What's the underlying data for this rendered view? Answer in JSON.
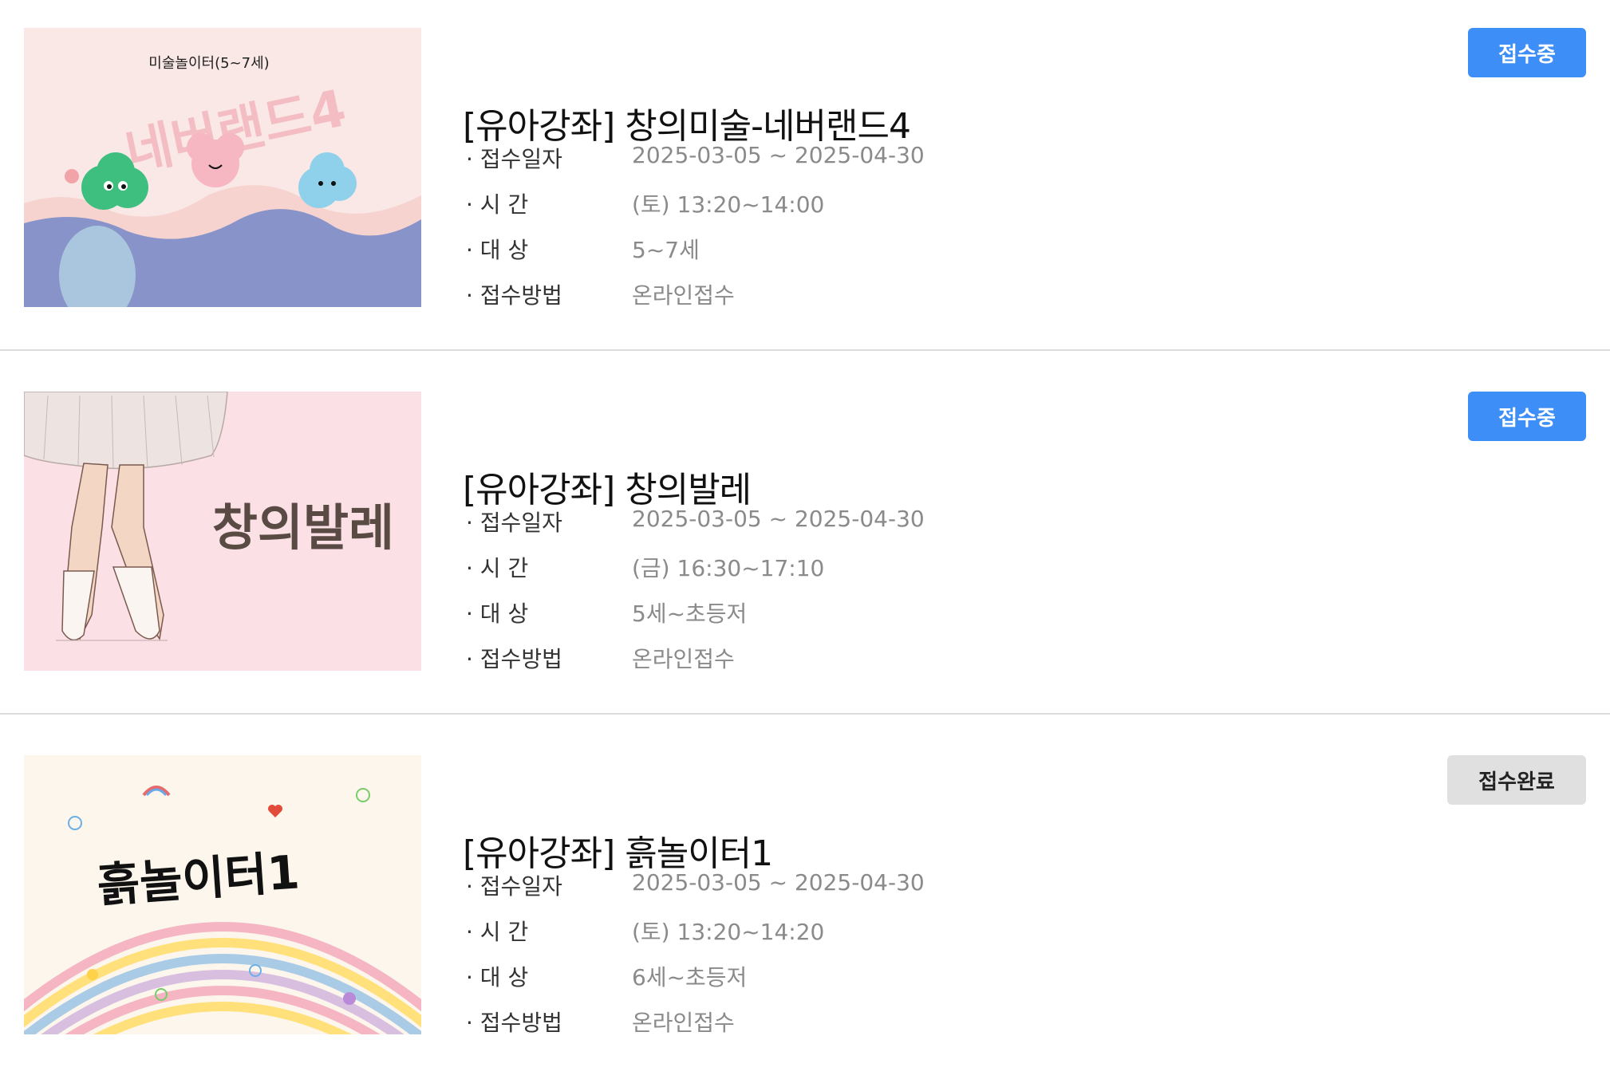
{
  "courses": [
    {
      "title": "[유아강좌] 창의미술-네버랜드4",
      "status": "접수중",
      "status_type": "open",
      "thumb_caption": "미술놀이터(5~7세)",
      "thumb_text": "네버랜드4",
      "rows": [
        {
          "label": "· 접수일자",
          "value": "2025-03-05 ~ 2025-04-30"
        },
        {
          "label": "· 시 간",
          "value": "(토) 13:20~14:00"
        },
        {
          "label": "· 대 상",
          "value": "5~7세"
        },
        {
          "label": "· 접수방법",
          "value": "온라인접수"
        }
      ]
    },
    {
      "title": "[유아강좌] 창의발레",
      "status": "접수중",
      "status_type": "open",
      "thumb_text": "창의발레",
      "rows": [
        {
          "label": "· 접수일자",
          "value": "2025-03-05 ~ 2025-04-30"
        },
        {
          "label": "· 시 간",
          "value": "(금) 16:30~17:10"
        },
        {
          "label": "· 대 상",
          "value": "5세~초등저"
        },
        {
          "label": "· 접수방법",
          "value": "온라인접수"
        }
      ]
    },
    {
      "title": "[유아강좌] 흙놀이터1",
      "status": "접수완료",
      "status_type": "closed",
      "thumb_text": "흙놀이터1",
      "rows": [
        {
          "label": "· 접수일자",
          "value": "2025-03-05 ~ 2025-04-30"
        },
        {
          "label": "· 시 간",
          "value": "(토) 13:20~14:20"
        },
        {
          "label": "· 대 상",
          "value": "6세~초등저"
        },
        {
          "label": "· 접수방법",
          "value": "온라인접수"
        }
      ]
    }
  ],
  "colors": {
    "open_badge": "#3e8ef7",
    "closed_badge": "#e0e0e0",
    "value_text": "#8a8a8a"
  }
}
